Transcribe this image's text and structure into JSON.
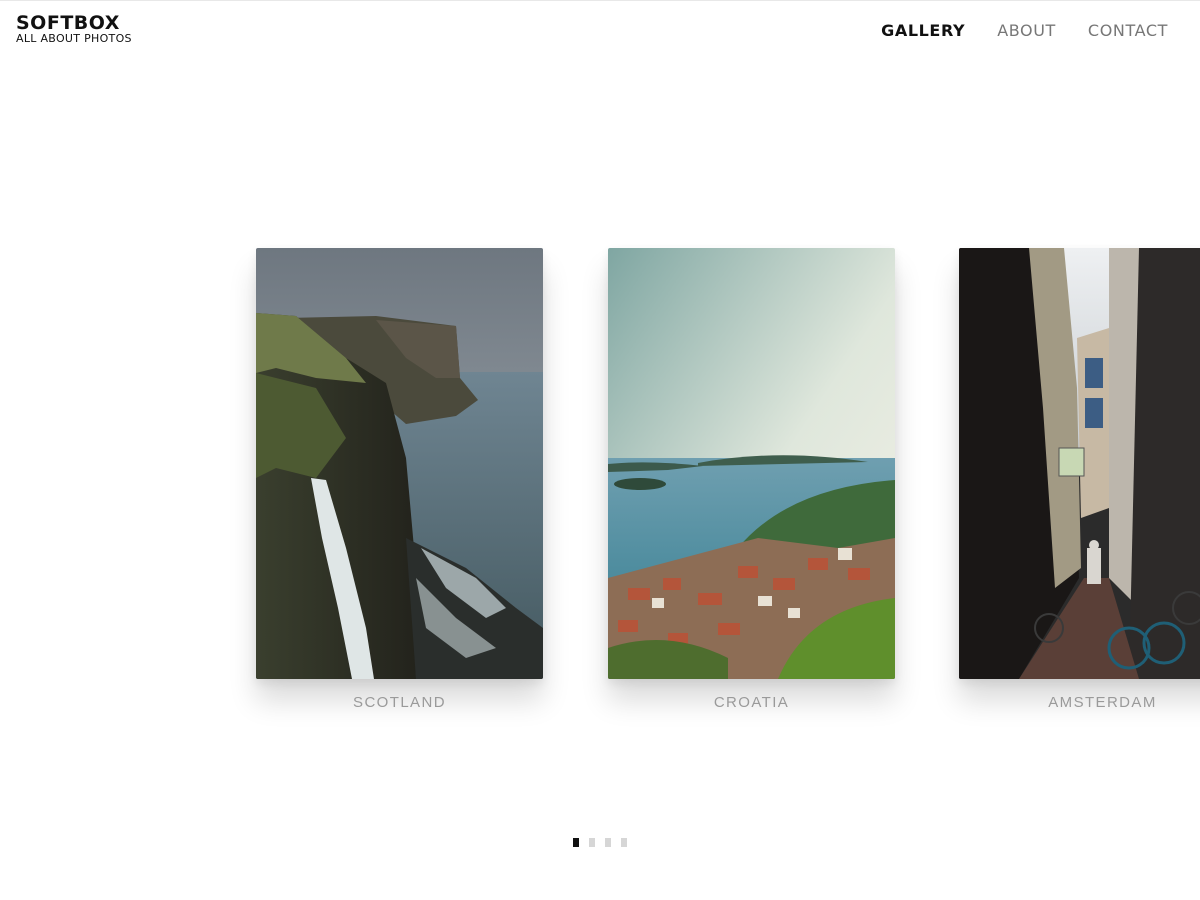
{
  "brand": {
    "title": "SOFTBOX",
    "subtitle": "ALL ABOUT PHOTOS"
  },
  "nav": {
    "items": [
      {
        "label": "GALLERY",
        "active": true
      },
      {
        "label": "ABOUT",
        "active": false
      },
      {
        "label": "CONTACT",
        "active": false
      }
    ]
  },
  "gallery": {
    "cards": [
      {
        "caption": "SCOTLAND",
        "image": "sea-cliff-waterfall-photo"
      },
      {
        "caption": "CROATIA",
        "image": "coastal-town-harbor-photo"
      },
      {
        "caption": "AMSTERDAM",
        "image": "narrow-alley-bicycles-photo"
      }
    ]
  },
  "pagination": {
    "total": 4,
    "current": 1
  },
  "colors": {
    "accent": "#111111",
    "caption": "#9a9a9a",
    "nav_inactive": "#777777",
    "dot_inactive": "#d6d6d6"
  }
}
